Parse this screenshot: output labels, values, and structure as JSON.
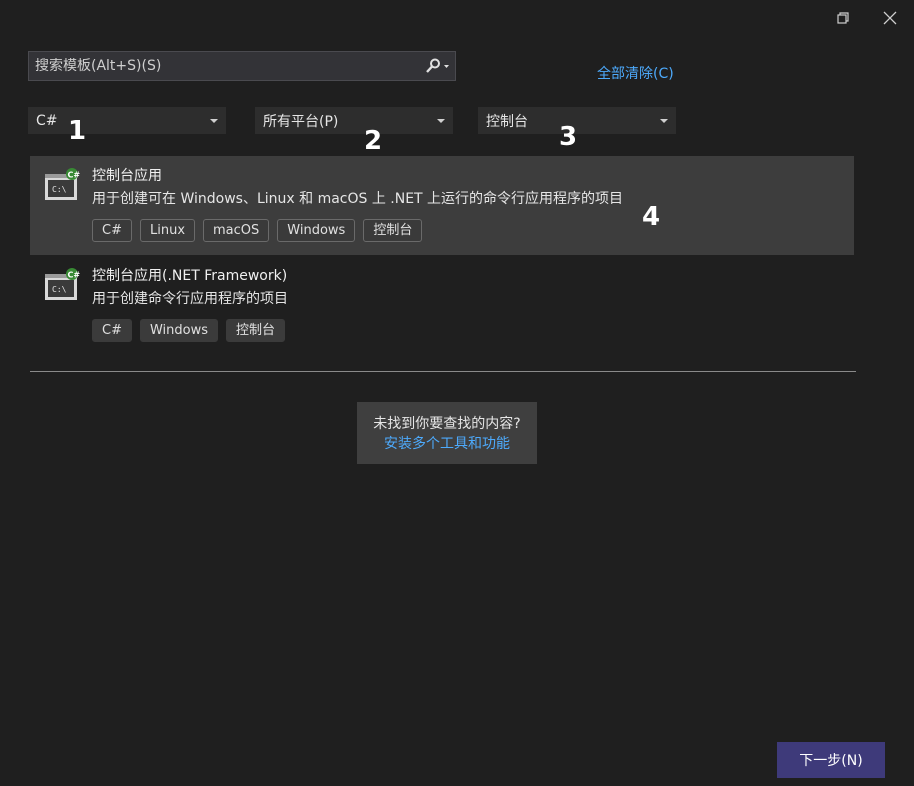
{
  "window": {
    "restore_icon": "restore-icon",
    "close_icon": "close-icon"
  },
  "search": {
    "placeholder": "搜索模板(Alt+S)(S)",
    "value": ""
  },
  "clear_all": "全部清除(C)",
  "filters": {
    "language": "C#",
    "platform": "所有平台(P)",
    "project_type": "控制台"
  },
  "step_markers": [
    "1",
    "2",
    "3",
    "4"
  ],
  "templates": [
    {
      "title": "控制台应用",
      "description": "用于创建可在 Windows、Linux 和 macOS 上 .NET 上运行的命令行应用程序的项目",
      "tags": [
        "C#",
        "Linux",
        "macOS",
        "Windows",
        "控制台"
      ],
      "icon": "csharp-console-icon"
    },
    {
      "title": "控制台应用(.NET Framework)",
      "description": "用于创建命令行应用程序的项目",
      "tags": [
        "C#",
        "Windows",
        "控制台"
      ],
      "icon": "csharp-console-icon"
    }
  ],
  "not_found": {
    "text": "未找到你要查找的内容?",
    "link": "安装多个工具和功能"
  },
  "next_button": "下一步(N)",
  "colors": {
    "accent": "#3e3a7a",
    "link": "#4daafc",
    "selected_bg": "#3d3d3d"
  }
}
